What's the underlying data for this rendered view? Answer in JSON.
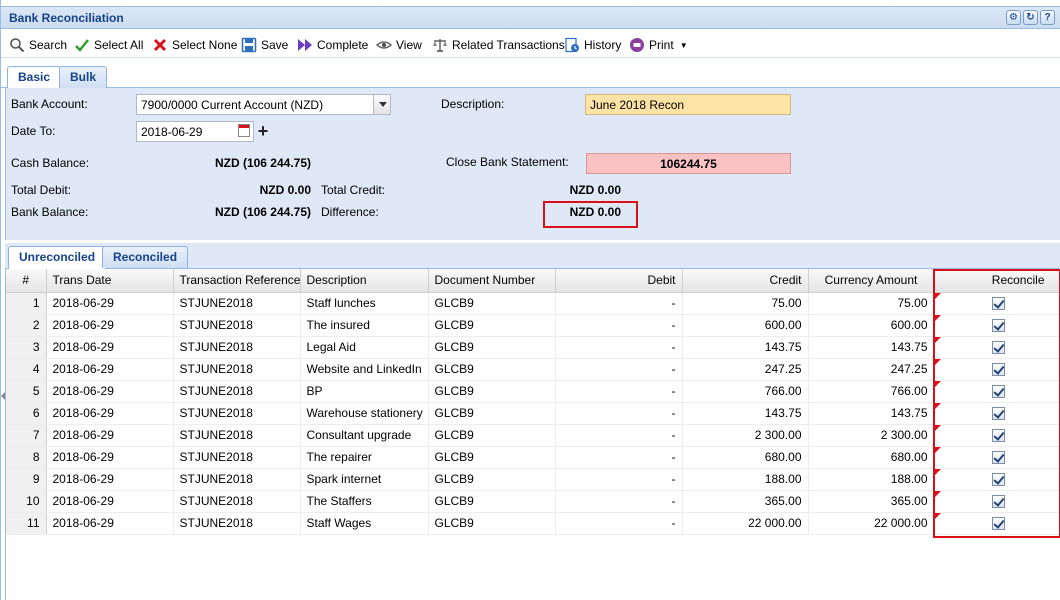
{
  "window": {
    "title": "Bank Reconciliation"
  },
  "toolbar": {
    "search": "Search",
    "select_all": "Select All",
    "select_none": "Select None",
    "save": "Save",
    "complete": "Complete",
    "view": "View",
    "related": "Related Transactions",
    "history": "History",
    "print": "Print"
  },
  "top_tabs": [
    "Basic",
    "Bulk"
  ],
  "form": {
    "bank_account_label": "Bank Account:",
    "bank_account_value": "7900/0000 Current Account (NZD)",
    "description_label": "Description:",
    "description_value": "June 2018 Recon",
    "date_to_label": "Date To:",
    "date_to_value": "2018-06-29",
    "cash_balance_label": "Cash Balance:",
    "cash_balance_value": "NZD (106 244.75)",
    "close_stmt_label": "Close Bank Statement:",
    "close_stmt_value": "106244.75",
    "total_debit_label": "Total Debit:",
    "total_debit_value": "NZD 0.00",
    "total_credit_label": "Total Credit:",
    "total_credit_value": "NZD 0.00",
    "bank_balance_label": "Bank Balance:",
    "bank_balance_value": "NZD (106 244.75)",
    "difference_label": "Difference:",
    "difference_value": "NZD 0.00"
  },
  "grid_tabs": [
    "Unreconciled",
    "Reconciled"
  ],
  "grid": {
    "columns": [
      "#",
      "Trans Date",
      "Transaction Reference",
      "Description",
      "Document Number",
      "Debit",
      "Credit",
      "Currency Amount",
      "Reconcile"
    ],
    "rows": [
      {
        "n": "1",
        "date": "2018-06-29",
        "ref": "STJUNE2018",
        "desc": "Staff lunches",
        "doc": "GLCB9",
        "debit": "-",
        "credit": "75.00",
        "amt": "75.00"
      },
      {
        "n": "2",
        "date": "2018-06-29",
        "ref": "STJUNE2018",
        "desc": "The insured",
        "doc": "GLCB9",
        "debit": "-",
        "credit": "600.00",
        "amt": "600.00"
      },
      {
        "n": "3",
        "date": "2018-06-29",
        "ref": "STJUNE2018",
        "desc": "Legal Aid",
        "doc": "GLCB9",
        "debit": "-",
        "credit": "143.75",
        "amt": "143.75"
      },
      {
        "n": "4",
        "date": "2018-06-29",
        "ref": "STJUNE2018",
        "desc": "Website and LinkedIn",
        "doc": "GLCB9",
        "debit": "-",
        "credit": "247.25",
        "amt": "247.25"
      },
      {
        "n": "5",
        "date": "2018-06-29",
        "ref": "STJUNE2018",
        "desc": "BP",
        "doc": "GLCB9",
        "debit": "-",
        "credit": "766.00",
        "amt": "766.00"
      },
      {
        "n": "6",
        "date": "2018-06-29",
        "ref": "STJUNE2018",
        "desc": "Warehouse stationery",
        "doc": "GLCB9",
        "debit": "-",
        "credit": "143.75",
        "amt": "143.75"
      },
      {
        "n": "7",
        "date": "2018-06-29",
        "ref": "STJUNE2018",
        "desc": "Consultant upgrade",
        "doc": "GLCB9",
        "debit": "-",
        "credit": "2 300.00",
        "amt": "2 300.00"
      },
      {
        "n": "8",
        "date": "2018-06-29",
        "ref": "STJUNE2018",
        "desc": "The repairer",
        "doc": "GLCB9",
        "debit": "-",
        "credit": "680.00",
        "amt": "680.00"
      },
      {
        "n": "9",
        "date": "2018-06-29",
        "ref": "STJUNE2018",
        "desc": "Spark internet",
        "doc": "GLCB9",
        "debit": "-",
        "credit": "188.00",
        "amt": "188.00"
      },
      {
        "n": "10",
        "date": "2018-06-29",
        "ref": "STJUNE2018",
        "desc": "The Staffers",
        "doc": "GLCB9",
        "debit": "-",
        "credit": "365.00",
        "amt": "365.00"
      },
      {
        "n": "11",
        "date": "2018-06-29",
        "ref": "STJUNE2018",
        "desc": "Staff Wages",
        "doc": "GLCB9",
        "debit": "-",
        "credit": "22 000.00",
        "amt": "22 000.00"
      }
    ]
  },
  "colors": {
    "highlight_red": "#d9101a",
    "description_bg": "#fde3a6",
    "close_stmt_bg": "#fbc2c4",
    "form_bg": "#dfe8f6"
  }
}
